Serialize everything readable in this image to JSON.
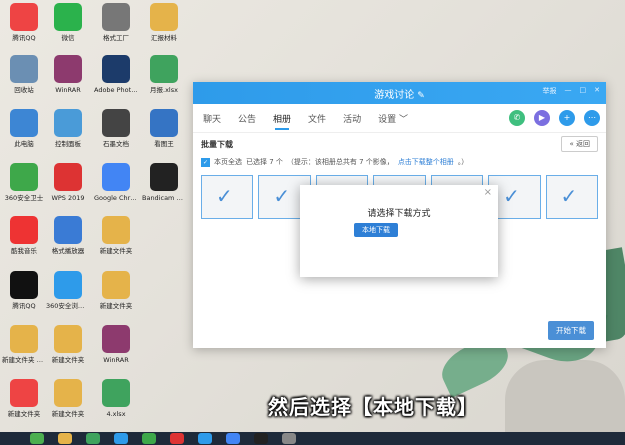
{
  "desktop": {
    "icons": [
      {
        "label": "腾讯QQ",
        "icon": "qq-icon",
        "color": "#e44"
      },
      {
        "label": "微信",
        "icon": "wechat-icon",
        "color": "#2bb24c"
      },
      {
        "label": "格式工厂",
        "icon": "format-factory-icon",
        "color": "#777"
      },
      {
        "label": "汇报材料",
        "icon": "folder-icon",
        "color": "#e5b34a"
      },
      {
        "label": "回收站",
        "icon": "recycle-bin-icon",
        "color": "#6b8fb3"
      },
      {
        "label": "WinRAR",
        "icon": "winrar-icon",
        "color": "#8d3a6e"
      },
      {
        "label": "Adobe Photosho...",
        "icon": "photoshop-icon",
        "color": "#1c3b6a"
      },
      {
        "label": "月报.xlsx",
        "icon": "excel-icon",
        "color": "#3fa35e"
      },
      {
        "label": "此电脑",
        "icon": "computer-icon",
        "color": "#3d86d4"
      },
      {
        "label": "控制面板",
        "icon": "control-panel-icon",
        "color": "#4a9bd8"
      },
      {
        "label": "石墨文档",
        "icon": "shimo-icon",
        "color": "#444"
      },
      {
        "label": "看图王",
        "icon": "image-viewer-icon",
        "color": "#3574c4"
      },
      {
        "label": "360安全卫士",
        "icon": "360-icon",
        "color": "#3ea84a"
      },
      {
        "label": "WPS 2019",
        "icon": "wps-icon",
        "color": "#d33"
      },
      {
        "label": "Google Chrome",
        "icon": "chrome-icon",
        "color": "#4285f4"
      },
      {
        "label": "Bandicam 2020 07",
        "icon": "bandicam-icon",
        "color": "#222"
      },
      {
        "label": "酷我音乐",
        "icon": "kuwo-icon",
        "color": "#e33"
      },
      {
        "label": "格式播放器",
        "icon": "video-player-icon",
        "color": "#3a7bd5"
      },
      {
        "label": "新建文件夹",
        "icon": "folder-icon",
        "color": "#e5b34a"
      },
      {
        "label": "",
        "icon": "blank",
        "color": "transparent"
      },
      {
        "label": "腾讯QQ",
        "icon": "qq-icon",
        "color": "#111"
      },
      {
        "label": "360安全浏览器",
        "icon": "ie-icon",
        "color": "#2e9bea"
      },
      {
        "label": "新建文件夹",
        "icon": "folder-icon",
        "color": "#e5b34a"
      },
      {
        "label": "",
        "icon": "blank",
        "color": "transparent"
      },
      {
        "label": "新建文件夹 v6.7",
        "icon": "folder-icon",
        "color": "#e5b34a"
      },
      {
        "label": "新建文件夹",
        "icon": "folder-icon",
        "color": "#e5b34a"
      },
      {
        "label": "WinRAR",
        "icon": "winrar-icon",
        "color": "#8d3a6e"
      },
      {
        "label": "",
        "icon": "blank",
        "color": "transparent"
      },
      {
        "label": "新建文件夹",
        "icon": "folder-icon",
        "color": "#e44"
      },
      {
        "label": "新建文件夹",
        "icon": "folder-icon",
        "color": "#e5b34a"
      },
      {
        "label": "4.xlsx",
        "icon": "excel-icon",
        "color": "#3fa35e"
      }
    ]
  },
  "window": {
    "title": "游戏讨论",
    "title_icon": "edit-pencil-icon",
    "title_right": [
      "举报",
      "—",
      "□",
      "✕"
    ],
    "tabs": [
      "聊天",
      "公告",
      "相册",
      "文件",
      "活动",
      "设置 ﹀"
    ],
    "active_tab": "相册",
    "section_title": "批量下载",
    "back_label": "返回",
    "select_all": "本页全选",
    "selected_count": "已选择 7 个",
    "hint": "（提示：该相册总共有 7 个影像，",
    "hint_link": "点击下载整个相册",
    "hint_end": "。）",
    "start_download": "开始下载"
  },
  "modal": {
    "title": "请选择下载方式",
    "button": "本地下载",
    "close": "×"
  },
  "subtitle": "然后选择【本地下载】",
  "colors": {
    "accent": "#2e9bea",
    "button": "#2e7fd6"
  }
}
